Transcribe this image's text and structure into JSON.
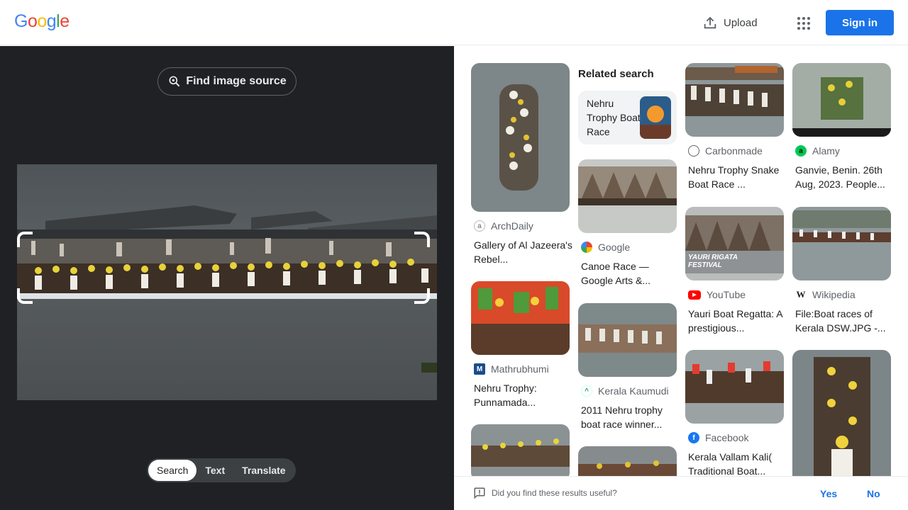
{
  "header": {
    "logo": [
      "G",
      "o",
      "o",
      "g",
      "l",
      "e"
    ],
    "logo_colors": [
      "#4285f4",
      "#ea4335",
      "#fbbc05",
      "#4285f4",
      "#34a853",
      "#ea4335"
    ],
    "upload_label": "Upload",
    "sign_in_label": "Sign in"
  },
  "left": {
    "find_source_label": "Find image source",
    "tabs": [
      "Search",
      "Text",
      "Translate"
    ],
    "active_tab": "Search"
  },
  "results": {
    "related_heading": "Related search",
    "related_label": "Nehru Trophy Boat Race",
    "items": [
      {
        "source": "ArchDaily",
        "title": "Gallery of Al Jazeera's Rebel..."
      },
      {
        "source": "Mathrubhumi",
        "title": "Nehru Trophy: Punnamada..."
      },
      {
        "source": "Google",
        "title": "Canoe Race — Google Arts &..."
      },
      {
        "source": "Kerala Kaumudi",
        "title": "2011 Nehru trophy boat race winner..."
      },
      {
        "source": "Carbonmade",
        "title": "Nehru Trophy Snake Boat Race ..."
      },
      {
        "source": "YouTube",
        "title": "Yauri Boat Regatta: A prestigious..."
      },
      {
        "source": "Facebook",
        "title": "Kerala Vallam Kali( Traditional Boat..."
      },
      {
        "source": "Alamy",
        "title": "Ganvie, Benin. 26th Aug, 2023. People..."
      },
      {
        "source": "Wikipedia",
        "title": "File:Boat races of Kerala DSW.JPG -..."
      }
    ],
    "overlay_text": "YAURI RIGATA FESTIVAL"
  },
  "footer": {
    "question": "Did you find these results useful?",
    "yes": "Yes",
    "no": "No"
  }
}
